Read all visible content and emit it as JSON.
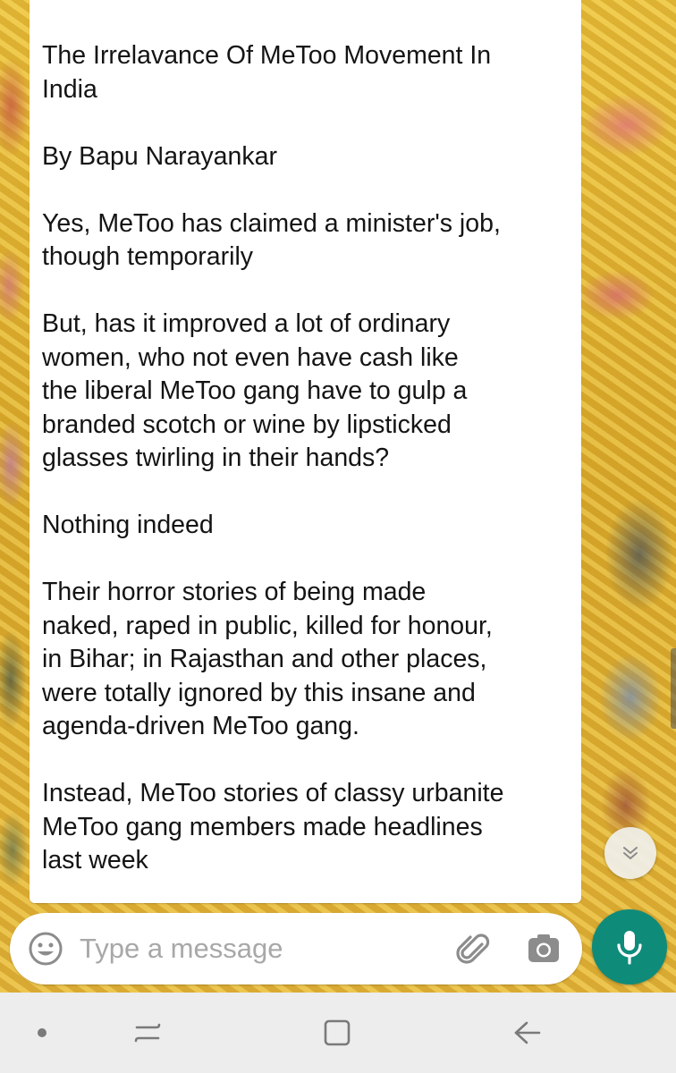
{
  "message": {
    "text": "The Irrelavance Of MeToo Movement In\nIndia\n\nBy Bapu Narayankar\n\nYes, MeToo has claimed a minister's job,\nthough temporarily\n\nBut, has it improved a lot of ordinary\nwomen, who not even have cash like\nthe liberal MeToo gang have to gulp a\nbranded scotch or wine by lipsticked\nglasses twirling in their hands?\n\nNothing indeed\n\nTheir horror stories of being made\nnaked, raped in public, killed for honour,\nin Bihar; in Rajasthan and other places,\nwere totally ignored by this insane and\nagenda-driven MeToo gang.\n\nInstead, MeToo stories of classy urbanite\nMeToo gang members made headlines\nlast week"
  },
  "composer": {
    "placeholder": "Type a message",
    "value": ""
  },
  "icons": {
    "scroll_down": "double-chevron-down-icon",
    "emoji": "smiley-icon",
    "attach": "paperclip-icon",
    "camera": "camera-icon",
    "mic": "microphone-icon",
    "nav_dot": "dot-icon",
    "nav_recents": "recent-apps-icon",
    "nav_home": "home-icon",
    "nav_back": "back-arrow-icon"
  },
  "colors": {
    "accent": "#0f8b7a",
    "bubble": "#ffffff",
    "nav_bar": "#ededed"
  }
}
